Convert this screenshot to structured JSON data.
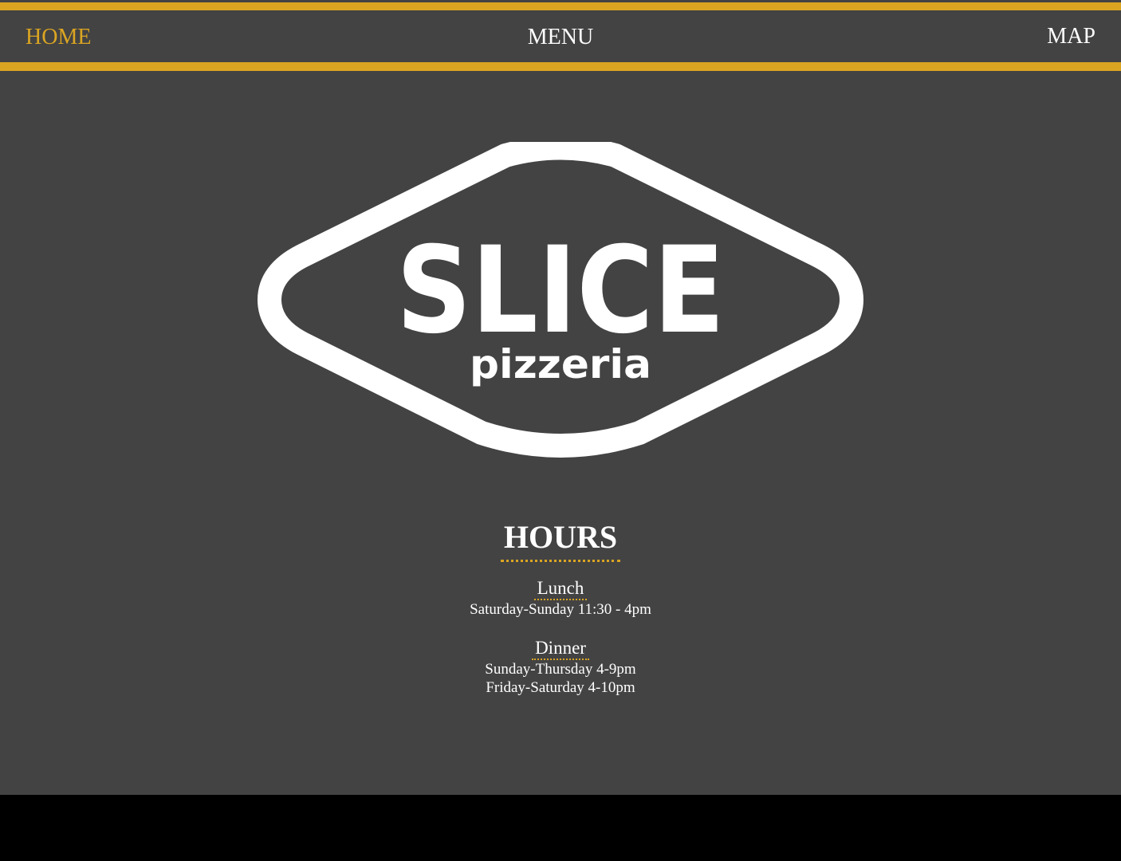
{
  "nav": {
    "home": "HOME",
    "menu": "MENU",
    "map": "MAP",
    "active": "HOME"
  },
  "logo": {
    "title": "SLICE",
    "subtitle": "pizzeria"
  },
  "hours": {
    "title": "HOURS",
    "sections": [
      {
        "name": "Lunch",
        "lines": [
          "Saturday-Sunday 11:30 - 4pm"
        ]
      },
      {
        "name": "Dinner",
        "lines": [
          "Sunday-Thursday 4-9pm",
          "Friday-Saturday 4-10pm"
        ]
      }
    ]
  },
  "colors": {
    "accent": "#dba522",
    "background": "#434343",
    "footer": "#000000",
    "text": "#ffffff"
  }
}
